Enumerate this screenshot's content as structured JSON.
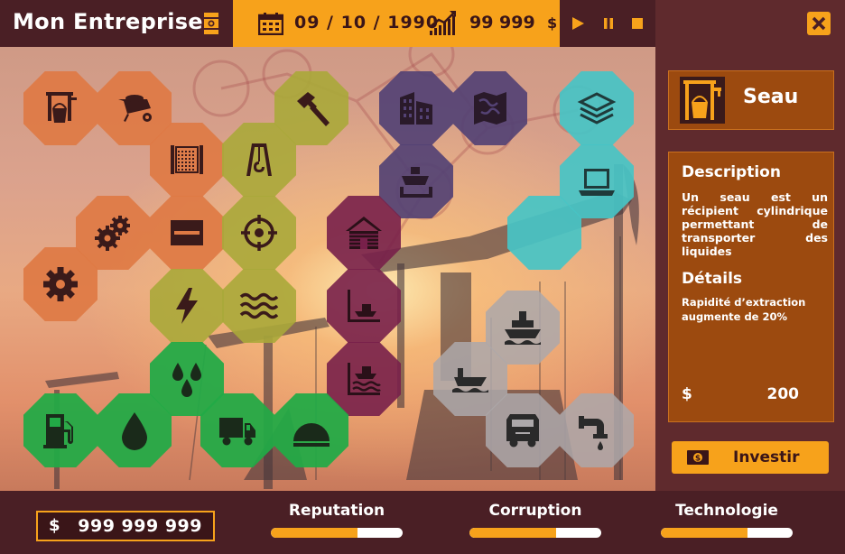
{
  "header": {
    "company_name": "Mon Entreprise",
    "date": "09 / 10 / 1990",
    "money": "99 999",
    "money_currency": "$"
  },
  "panel": {
    "item_name": "Seau",
    "description_title": "Description",
    "description_text": "Un seau est un récipient cylindrique permettant de transporter des liquides",
    "details_title": "Détails",
    "details_text": "Rapidité d’extraction augmente de 20%",
    "price_currency": "$",
    "price": "200",
    "invest_label": "Investir"
  },
  "footer": {
    "budget_currency": "$",
    "budget_value": "999 999 999",
    "stats": [
      {
        "label": "Reputation",
        "value": 0.66
      },
      {
        "label": "Corruption",
        "value": 0.66
      },
      {
        "label": "Technologie",
        "value": 0.66
      }
    ]
  },
  "colors": {
    "accent": "#f7a21b",
    "dark": "#4a1f25",
    "panel": "#5f2a2d",
    "panel_box": "#9c4a0f",
    "orange_tile": "#de7944",
    "olive_tile": "#aaa83a",
    "purple_tile": "#544274",
    "teal_tile": "#46c4c6",
    "magenta_tile": "#78204a",
    "green_tile": "#22aa46",
    "grey_tile": "#aca8aa"
  },
  "icons": [
    "bucket-icon",
    "wheelbarrow-icon",
    "hammer-icon",
    "office-icon",
    "map-icon",
    "layers-icon",
    "gate-icon",
    "crane-icon",
    "ship-dock-icon",
    "laptop-icon",
    "gears-icon",
    "panel-icon",
    "target-icon",
    "cabin-icon",
    "gear-icon",
    "lightning-icon",
    "waves-icon",
    "offshore-icon",
    "cargo-ship-icon",
    "drops-icon",
    "water-rig-icon",
    "tanker-icon",
    "fuel-pump-icon",
    "oil-drop-icon",
    "truck-icon",
    "dome-icon",
    "tank-truck-icon",
    "pipe-icon"
  ]
}
